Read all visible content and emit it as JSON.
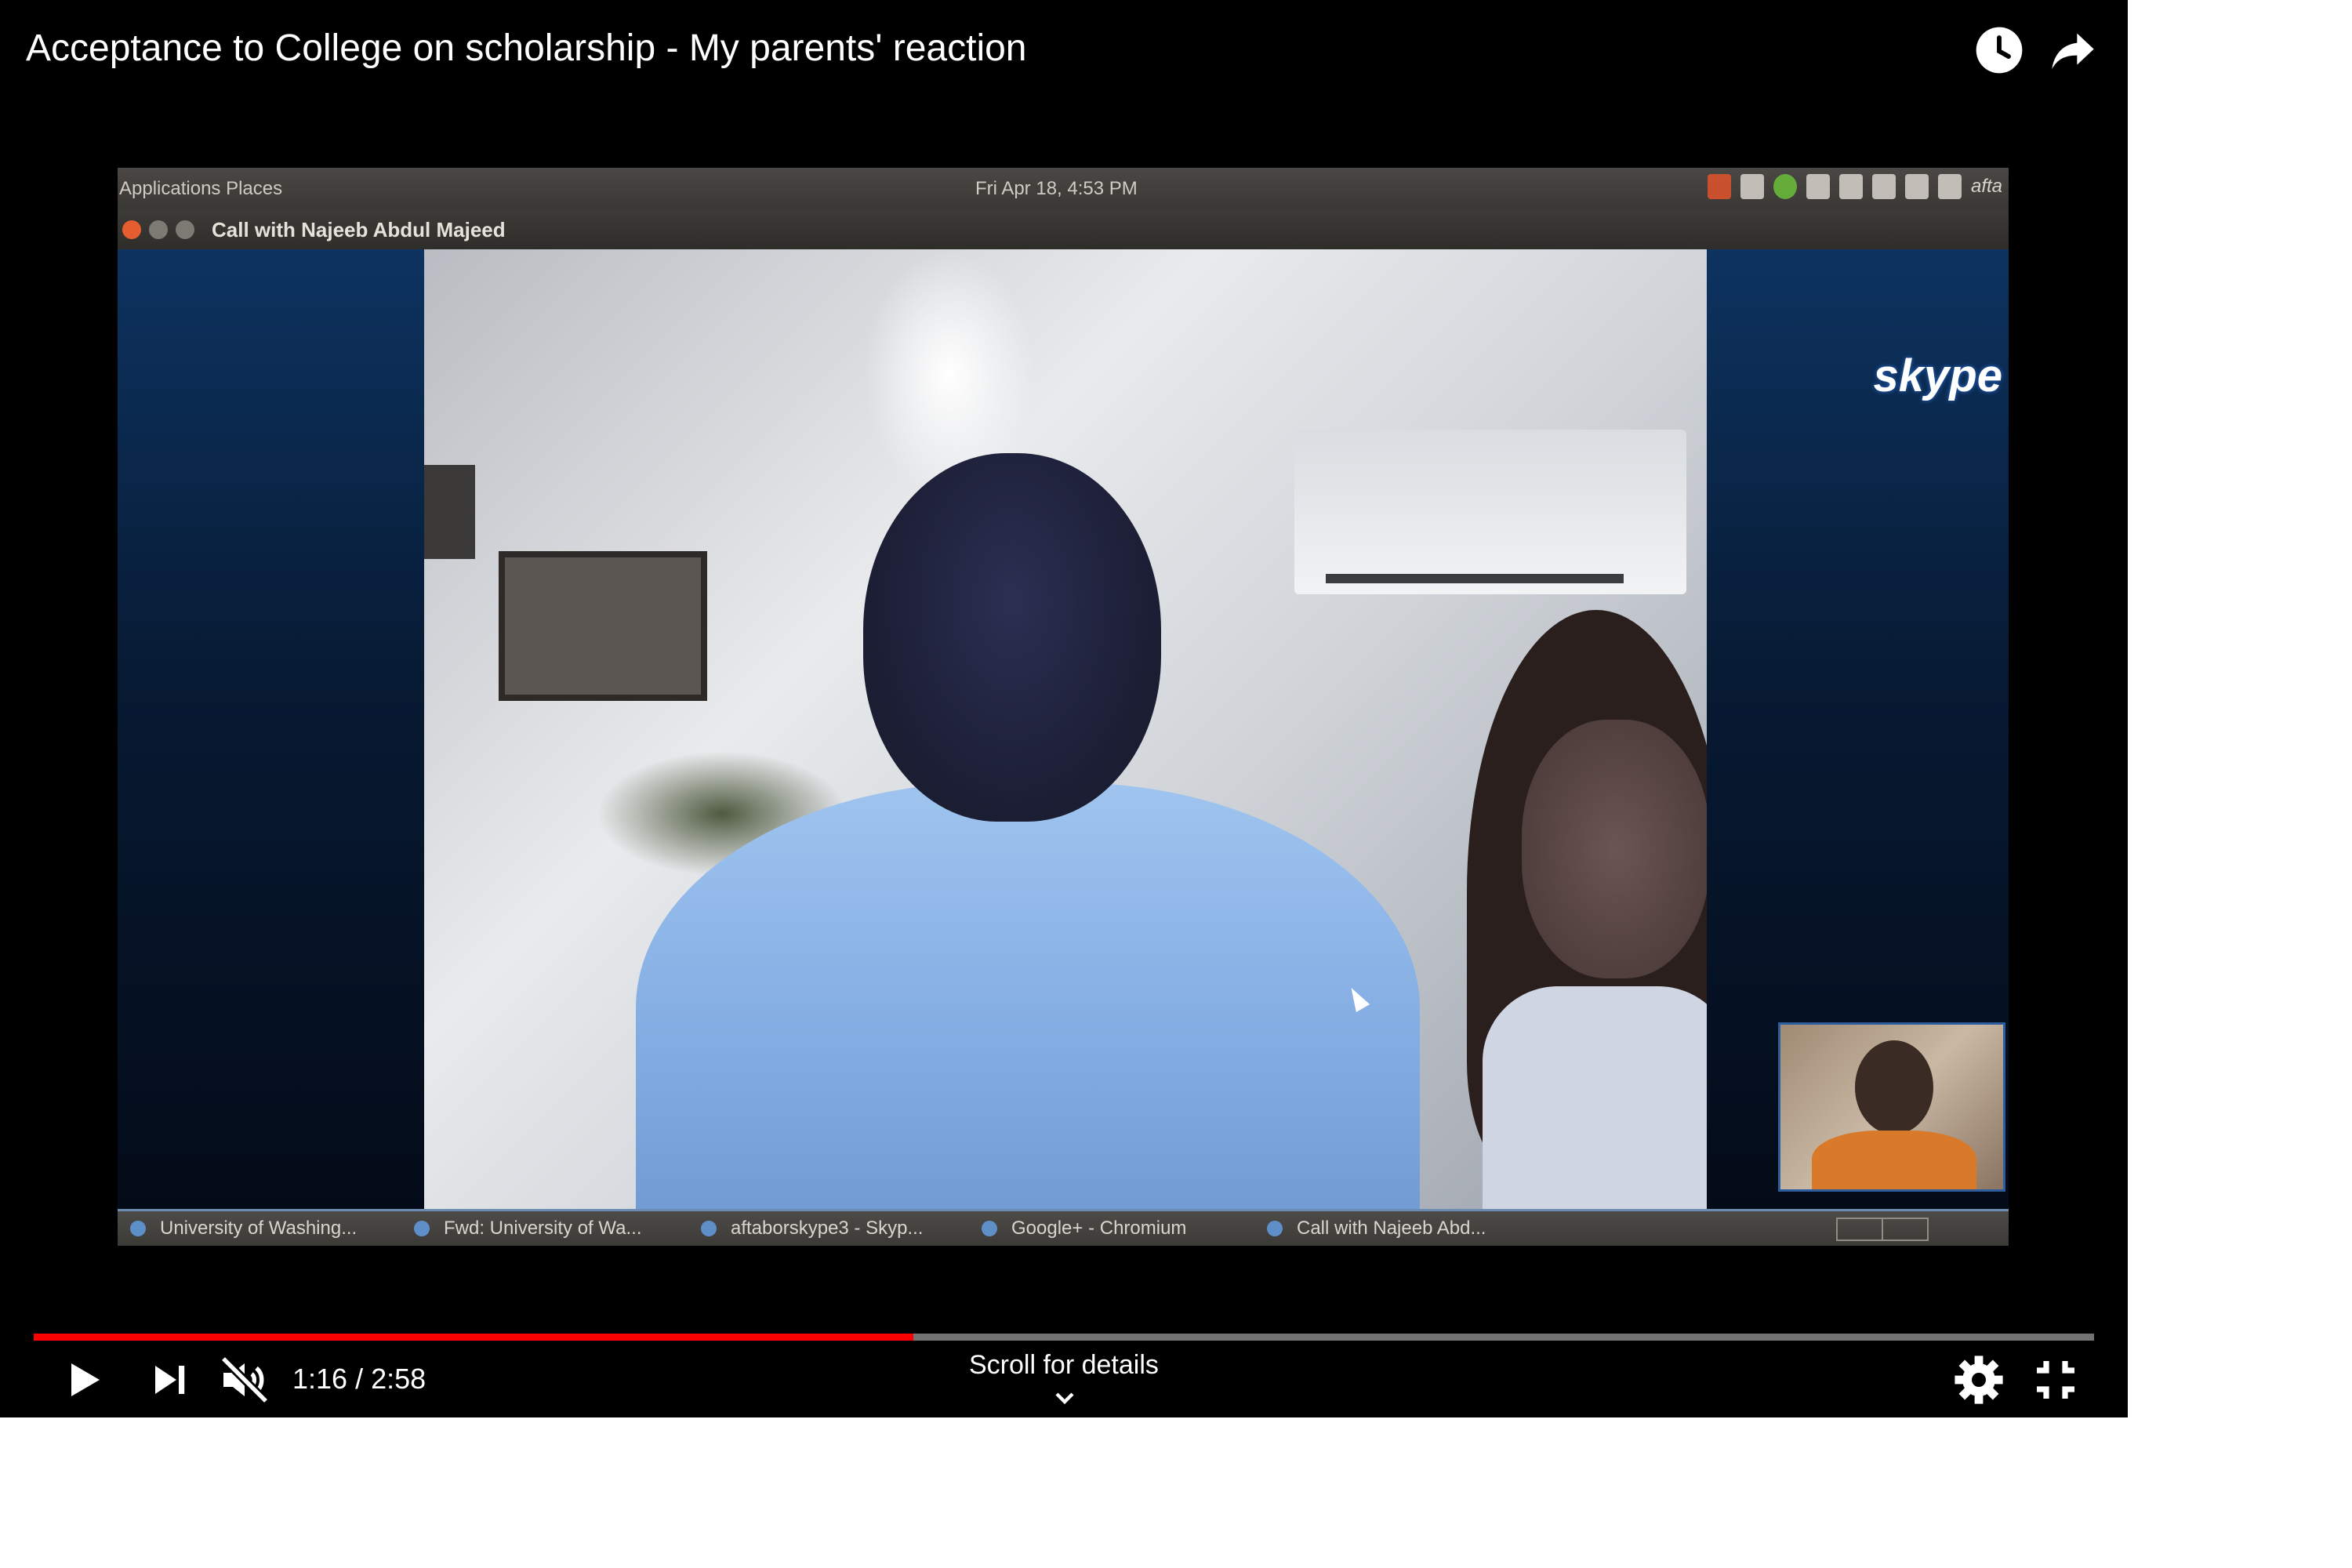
{
  "video": {
    "title": "Acceptance to College on scholarship - My parents' reaction"
  },
  "top_actions": {
    "watch_later_icon": "clock-icon",
    "share_icon": "share-arrow-icon"
  },
  "screen": {
    "panel_menu": "Applications  Places",
    "panel_clock": "Fri Apr 18, 4:53 PM",
    "panel_user": "afta",
    "window_title": "Call with Najeeb Abdul Majeed",
    "skype_logo": "skype",
    "taskbar": [
      "University of Washing...",
      "Fwd: University of Wa...",
      "aftaborskype3 - Skyp...",
      "Google+ - Chromium",
      "Call with Najeeb Abd..."
    ]
  },
  "controls": {
    "progress_fraction": 0.427,
    "time_display": "1:16 / 2:58",
    "scroll_label": "Scroll for details",
    "play_icon": "play-icon",
    "next_icon": "next-icon",
    "mute_icon": "volume-muted-icon",
    "settings_icon": "gear-icon",
    "exit_fullscreen_icon": "exit-fullscreen-icon"
  },
  "colors": {
    "progress": "#ff0000",
    "background": "#000000"
  }
}
